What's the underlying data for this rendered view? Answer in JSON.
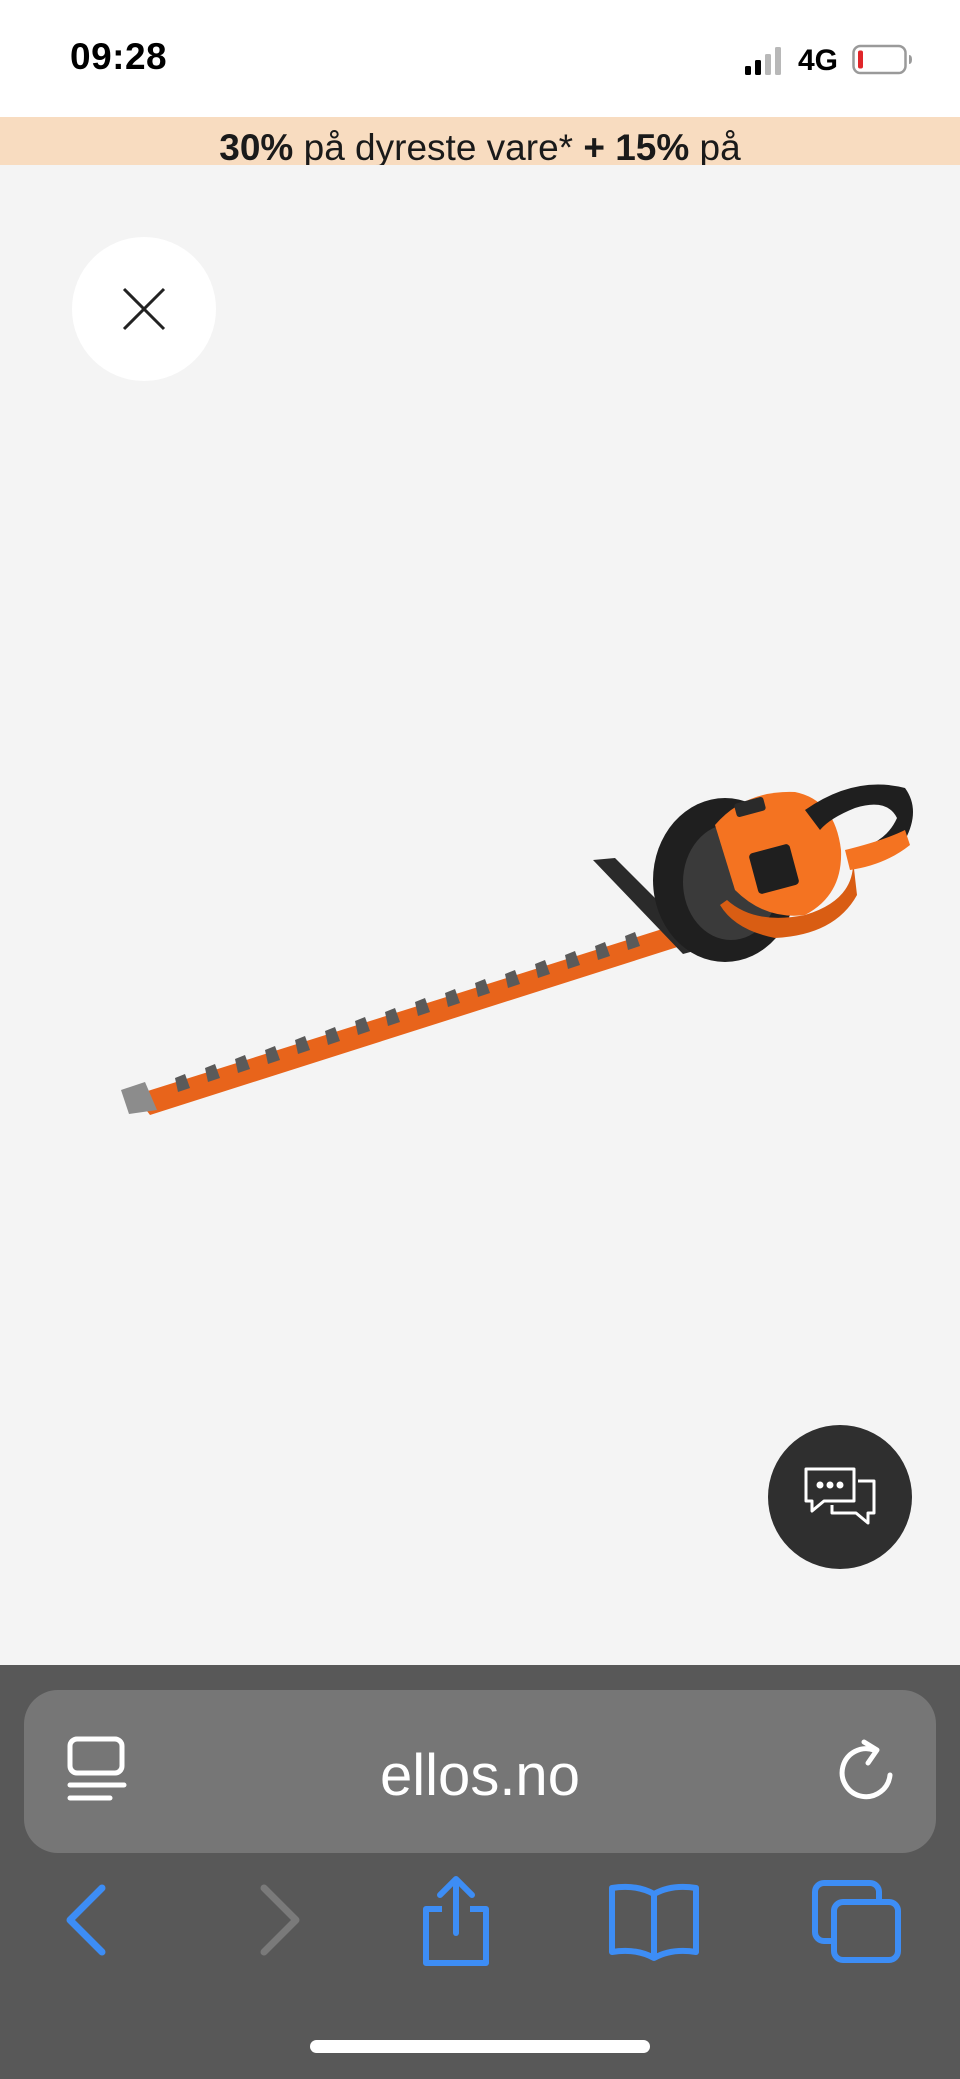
{
  "status_bar": {
    "time": "09:28",
    "network": "4G",
    "signal_bars_active": 2,
    "battery_level": 0.08,
    "battery_color": "#e0262a"
  },
  "promo": {
    "bold_1": "30%",
    "text_1": " på dyreste vare* ",
    "bold_2": "+ 15%",
    "text_2": " på",
    "background": "#f8dcc0"
  },
  "viewer": {
    "close_icon": "close-icon",
    "product": "hedge-trimmer",
    "product_brand_colors": [
      "#f47321",
      "#1f1f1f"
    ],
    "chat_icon": "chat-bubbles-icon"
  },
  "browser": {
    "url": "ellos.no",
    "reader_icon": "reader-mode-icon",
    "reload_icon": "reload-icon",
    "toolbar": [
      "back-icon",
      "forward-icon",
      "share-icon",
      "bookmarks-icon",
      "tabs-icon"
    ],
    "accent": "#3d8df5",
    "disabled": "#7a7a7a"
  }
}
